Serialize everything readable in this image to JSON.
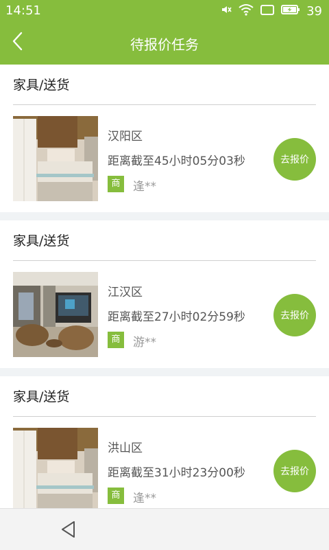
{
  "status": {
    "time": "14:51",
    "battery": "39"
  },
  "header": {
    "title": "待报价任务"
  },
  "tasks": [
    {
      "category": "家具/送货",
      "district": "汉阳区",
      "deadline": "距离截至45小时05分03秒",
      "badge": "商",
      "user": "逢**",
      "action": "去报价",
      "image": "bedroom"
    },
    {
      "category": "家具/送货",
      "district": "江汉区",
      "deadline": "距离截至27小时02分59秒",
      "badge": "商",
      "user": "游**",
      "action": "去报价",
      "image": "showroom"
    },
    {
      "category": "家具/送货",
      "district": "洪山区",
      "deadline": "距离截至31小时23分00秒",
      "badge": "商",
      "user": "逢**",
      "action": "去报价",
      "image": "bedroom"
    }
  ],
  "colors": {
    "accent": "#86bd3d"
  },
  "icons": [
    "mute-icon",
    "wifi-icon",
    "screen-icon",
    "battery-charging-icon",
    "back-arrow-icon",
    "nav-back-icon"
  ]
}
